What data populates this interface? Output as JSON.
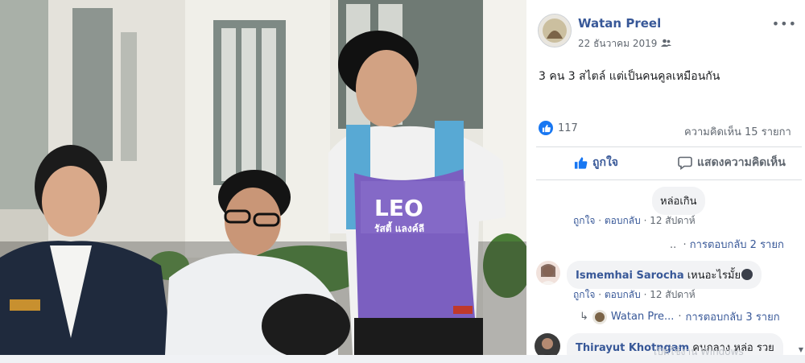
{
  "post": {
    "author": "Watan Preel",
    "date": "22 ธันวาคม 2019",
    "privacy_icon": "friends-icon",
    "text": "3 คน 3 สไตล์ แต่เป็นคนคูลเหมือนกัน",
    "like_count": "117",
    "comment_count": "ความคิดเห็น 15 รายกา",
    "more_label": "•••"
  },
  "actions": {
    "like_label": "ถูกใจ",
    "comment_label": "แสดงความคิดเห็น"
  },
  "comments": [
    {
      "author": "",
      "text": "หล่อเกิน",
      "meta": {
        "like": "ถูกใจ",
        "reply": "ตอบกลับ",
        "time": "12 สัปดาห์"
      },
      "replies_link": "การตอบกลับ 2 รายก"
    },
    {
      "author": "Ismemhai Sarocha",
      "text": "เหนอะไรมั้ย",
      "meta": {
        "like": "ถูกใจ",
        "reply": "ตอบกลับ",
        "time": "12 สัปดาห์"
      },
      "reply_preview_author": "Watan Pre...",
      "replies_link": "การตอบกลับ 3 รายก"
    },
    {
      "author": "Thirayut Khotngam",
      "text": "คนกลาง หล่อ รวย"
    }
  ],
  "photo_print": {
    "shirt_text": "LEO",
    "shirt_subtext": "รัสตี้ แลงค์ลี"
  },
  "watermark": "เปิดใช้งาน Windows",
  "colors": {
    "link": "#385898",
    "like_blue": "#1877f2",
    "secondary_text": "#606770",
    "bubble_bg": "#f2f3f5"
  }
}
